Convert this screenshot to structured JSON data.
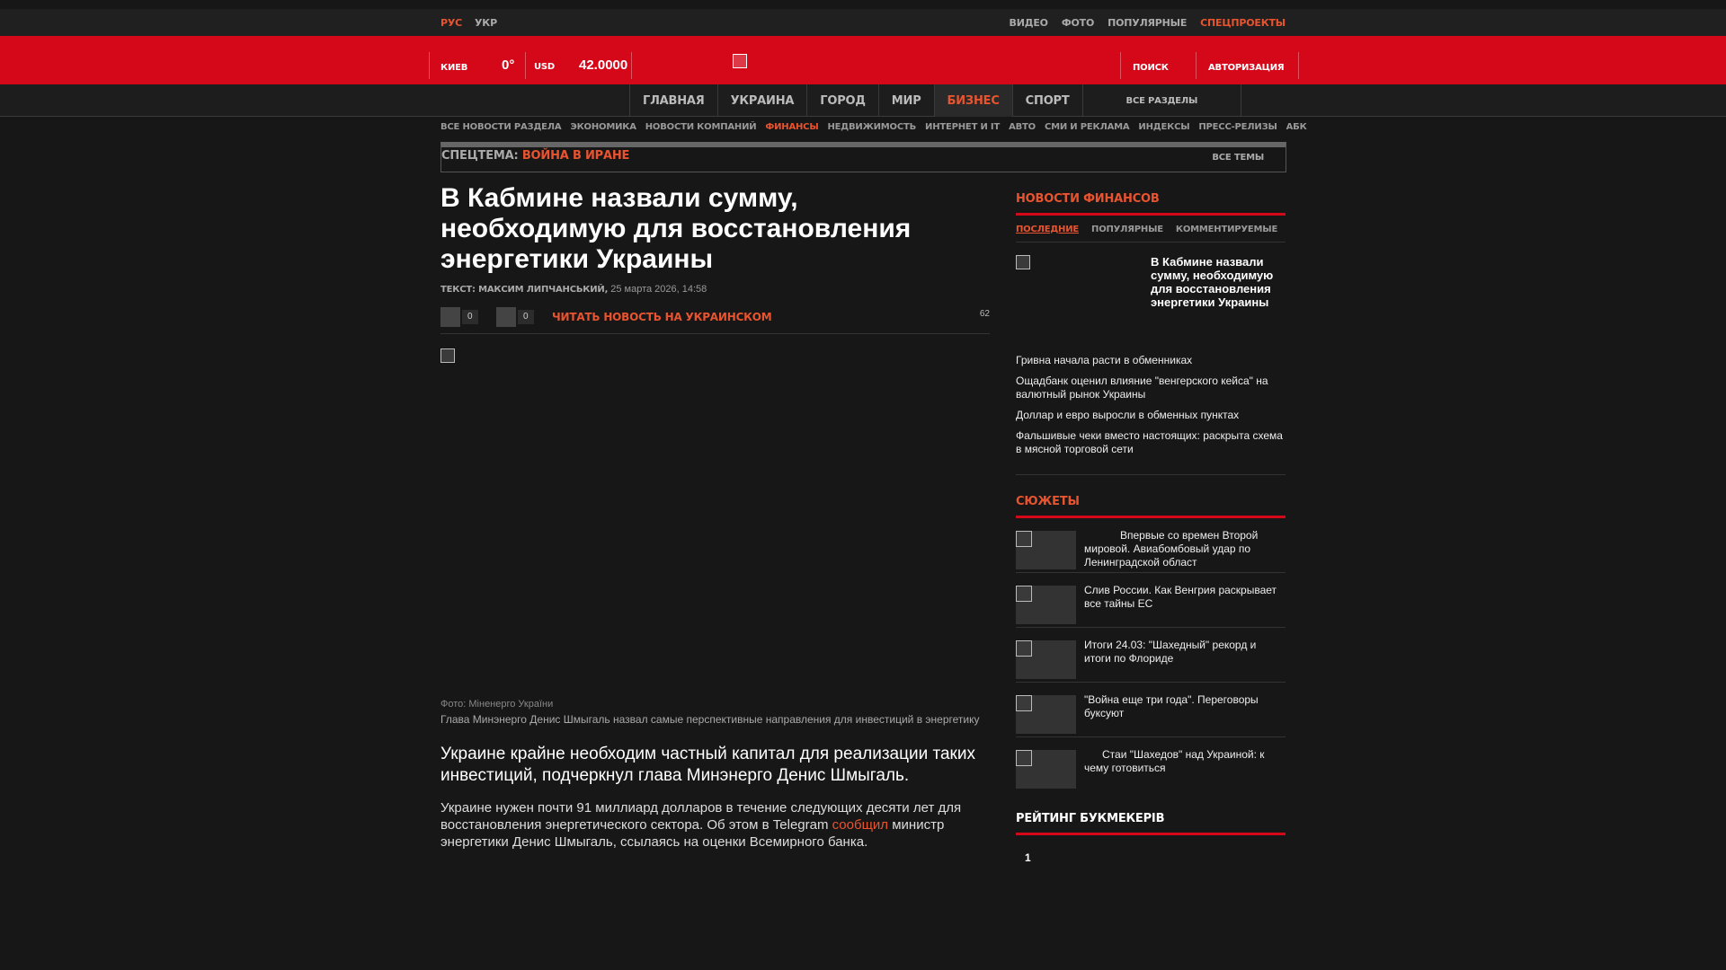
{
  "topbar": {
    "langs": [
      "РУС",
      "УКР"
    ],
    "right_links": [
      "ВИДЕО",
      "ФОТО",
      "ПОПУЛЯРНЫЕ",
      "СПЕЦПРОЕКТЫ"
    ]
  },
  "header": {
    "city": "КИЕВ",
    "temp": "0°",
    "currency": "USD",
    "rate": "42.0000",
    "search": "ПОИСК",
    "login": "АВТОРИЗАЦИЯ"
  },
  "nav": {
    "items": [
      "ГЛАВНАЯ",
      "УКРАИНА",
      "ГОРОД",
      "МИР",
      "БИЗНЕС",
      "СПОРТ"
    ],
    "all": "ВСЕ РАЗДЕЛЫ"
  },
  "subnav": [
    "ВСЕ НОВОСТИ РАЗДЕЛА",
    "ЭКОНОМИКА",
    "НОВОСТИ КОМПАНИЙ",
    "ФИНАНСЫ",
    "НЕДВИЖИМОСТЬ",
    "ИНТЕРНЕТ И IT",
    "АВТО",
    "СМИ И РЕКЛАМА",
    "ИНДЕКСЫ",
    "ПРЕСС-РЕЛИЗЫ",
    "АБК"
  ],
  "topic": {
    "label": "СПЕЦТЕМА:",
    "name": "ВОЙНА В ИРАНЕ",
    "all": "ВСЕ ТЕМЫ"
  },
  "article": {
    "title": "В Кабмине назвали сумму, необходимую для восстановления энергетики Украины",
    "author_label": "ТЕКСТ: МАКСИМ ЛИПЧАНСЬКИЙ,",
    "date": "25 марта 2026, 14:58",
    "share1_count": "0",
    "share2_count": "0",
    "ukr_link": "ЧИТАТЬ НОВОСТЬ НА УКРАИНСКОМ",
    "views": "62",
    "photo_credit": "Фото: Міненерго України",
    "caption": "Глава Минэнерго Денис Шмыгаль назвал самые перспективные направления для инвестиций в энергетику",
    "lead": "Украине крайне необходим частный капитал для реализации таких инвестиций, подчеркнул глава Минэнерго Денис Шмыгаль.",
    "body_before": "Украине нужен почти 91 миллиард долларов в течение следующих десяти лет для восстановления энергетического сектора. Об этом в Telegram ",
    "body_link": "сообщил",
    "body_after": " министр энергетики Денис Шмыгаль, ссылаясь на оценки Всемирного банка."
  },
  "sidebar": {
    "news_title": "НОВОСТИ ФИНАНСОВ",
    "tabs": [
      "ПОСЛЕДНИЕ",
      "ПОПУЛЯРНЫЕ",
      "КОММЕНТИРУЕМЫЕ"
    ],
    "featured": "В Кабмине назвали сумму, необходимую для восстановления энергетики Украины",
    "news": [
      "Гривна начала расти в обменниках",
      "Ощадбанк оценил влияние \"венгерского кейса\" на валютный рынок Украины",
      "Доллар и евро выросли в обменных пунктах",
      "Фальшивые чеки вместо настоящих: раскрыта схема в мясной торговой сети"
    ],
    "stories_title": "СЮЖЕТЫ",
    "stories": [
      "Впервые со времен Второй мировой. Авиабомбовый удар по Ленинградской област",
      "Слив России. Как Венгрия раскрывает все тайны ЕС",
      "Итоги 24.03: \"Шахедный\" рекорд и итоги по Флориде",
      "\"Война еще три года\". Переговоры буксуют",
      "Стаи \"Шахедов\" над Украиной: к чему готовиться"
    ],
    "rating_title": "РЕЙТИНГ БУКМЕКЕРІВ",
    "rating_first": "1"
  },
  "colors": {
    "brand_red": "#d5081a",
    "accent": "#e8542f",
    "background": "#171717"
  }
}
